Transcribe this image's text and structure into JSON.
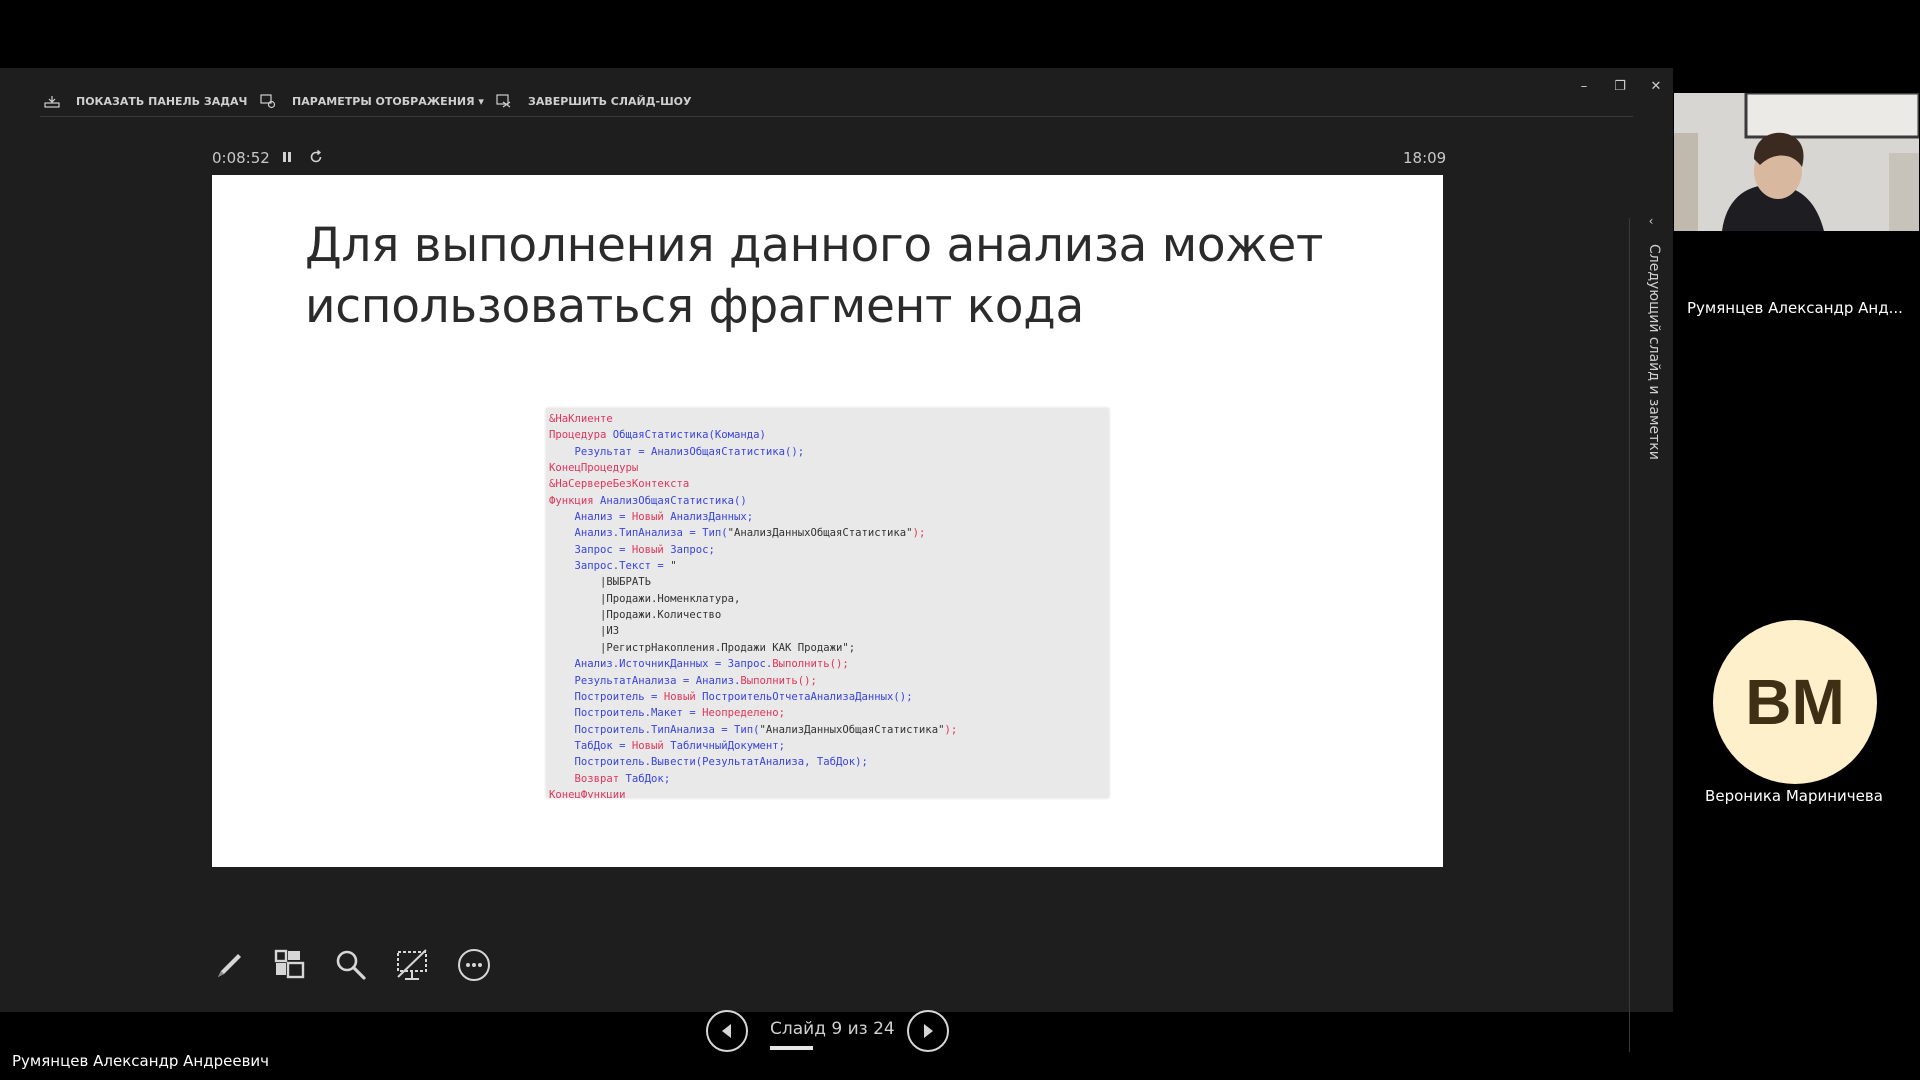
{
  "toolbar": {
    "show_taskbar": "ПОКАЗАТЬ ПАНЕЛЬ ЗАДАЧ",
    "display_settings": "ПАРАМЕТРЫ ОТОБРАЖЕНИЯ ▾",
    "end_show": "ЗАВЕРШИТЬ СЛАЙД-ШОУ"
  },
  "window_controls": {
    "minimize": "–",
    "restore": "❐",
    "close": "✕"
  },
  "timer": {
    "elapsed": "0:08:52",
    "pause_icon": "pause-icon",
    "reset_icon": "reset-icon",
    "clock": "18:09"
  },
  "slide": {
    "title": "Для выполнения данного анализа может использоваться фрагмент кода",
    "code": [
      [
        [
          "&НаКлиенте",
          "red"
        ]
      ],
      [
        [
          "Процедура ",
          "red"
        ],
        [
          "ОбщаяСтатистика(Команда)",
          "blue"
        ]
      ],
      [
        [
          "    Результат = АнализОбщаяСтатистика();",
          "blue"
        ]
      ],
      [
        [
          "КонецПроцедуры",
          "red"
        ]
      ],
      [
        [
          "&НаСервереБезКонтекста",
          "red"
        ]
      ],
      [
        [
          "Функция ",
          "red"
        ],
        [
          "АнализОбщаяСтатистика()",
          "blue"
        ]
      ],
      [
        [
          "    Анализ = ",
          "blue"
        ],
        [
          "Новый ",
          "red"
        ],
        [
          "АнализДанных;",
          "blue"
        ]
      ],
      [
        [
          "    Анализ.ТипАнализа = Тип(",
          "blue"
        ],
        [
          "\"АнализДанныхОбщаяСтатистика\"",
          "dark"
        ],
        [
          ");",
          "red"
        ]
      ],
      [
        [
          "    Запрос = ",
          "blue"
        ],
        [
          "Новый ",
          "red"
        ],
        [
          "Запрос;",
          "blue"
        ]
      ],
      [
        [
          "    Запрос.Текст = ",
          "blue"
        ],
        [
          "\"",
          "dark"
        ]
      ],
      [
        [
          "        |ВЫБРАТЬ",
          "dark"
        ]
      ],
      [
        [
          "        |Продажи.Номенклатура,",
          "dark"
        ]
      ],
      [
        [
          "        |Продажи.Количество",
          "dark"
        ]
      ],
      [
        [
          "        |ИЗ",
          "dark"
        ]
      ],
      [
        [
          "        |РегистрНакопления.Продажи КАК Продажи\";",
          "dark"
        ]
      ],
      [
        [
          "    Анализ.ИсточникДанных = Запрос.",
          "blue"
        ],
        [
          "Выполнить();",
          "red"
        ]
      ],
      [
        [
          "    РезультатАнализа = Анализ.",
          "blue"
        ],
        [
          "Выполнить();",
          "red"
        ]
      ],
      [
        [
          "    Построитель = ",
          "blue"
        ],
        [
          "Новый ",
          "red"
        ],
        [
          "ПостроительОтчетаАнализаДанных();",
          "blue"
        ]
      ],
      [
        [
          "    Построитель.Макет = ",
          "blue"
        ],
        [
          "Неопределено;",
          "red"
        ]
      ],
      [
        [
          "    Построитель.ТипАнализа = Тип(",
          "blue"
        ],
        [
          "\"АнализДанныхОбщаяСтатистика\"",
          "dark"
        ],
        [
          ");",
          "red"
        ]
      ],
      [
        [
          "    ТабДок = ",
          "blue"
        ],
        [
          "Новый ",
          "red"
        ],
        [
          "ТабличныйДокумент;",
          "blue"
        ]
      ],
      [
        [
          "    Построитель.Вывести(РезультатАнализа, ТабДок);",
          "blue"
        ]
      ],
      [
        [
          "    Возврат ",
          "red"
        ],
        [
          "ТабДок;",
          "blue"
        ]
      ],
      [
        [
          "КонецФункции",
          "red"
        ]
      ]
    ]
  },
  "tools": [
    "pen-icon",
    "all-slides-icon",
    "zoom-icon",
    "black-screen-icon",
    "more-options-icon"
  ],
  "navigation": {
    "counter": "Слайд 9 из 24",
    "current": 9,
    "total": 24
  },
  "side_panel": {
    "label": "Следующий слайд и заметки"
  },
  "participants": [
    {
      "name": "Румянцев Александр Анд...",
      "type": "camera"
    },
    {
      "name": "Вероника Мариничева",
      "initials": "ВМ",
      "avatar_color": "#fdf0cb"
    }
  ],
  "active_speaker": "Румянцев Александр Андреевич",
  "colors": {
    "code_red": "#e0365a",
    "code_blue": "#3a44e0",
    "presenter_bg": "#1e1e1e"
  }
}
